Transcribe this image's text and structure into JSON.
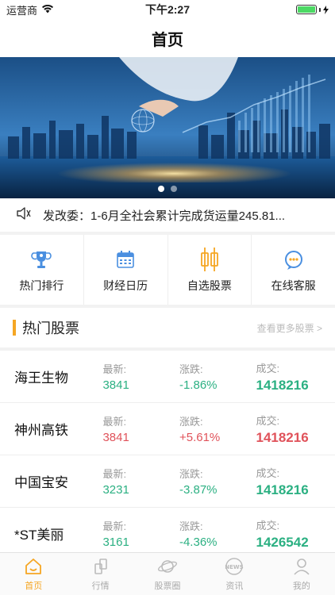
{
  "status": {
    "carrier": "运营商",
    "time": "下午2:27"
  },
  "nav": {
    "title": "首页"
  },
  "banner": {
    "slide_count": 2,
    "active_slide": 1
  },
  "news": {
    "text": "发改委：1-6月全社会累计完成货运量245.81..."
  },
  "quick_menu": [
    {
      "label": "热门排行",
      "icon": "trophy-icon"
    },
    {
      "label": "财经日历",
      "icon": "calendar-icon"
    },
    {
      "label": "自选股票",
      "icon": "candlestick-icon"
    },
    {
      "label": "在线客服",
      "icon": "support-chat-icon"
    }
  ],
  "section": {
    "title": "热门股票",
    "more": "查看更多股票 >"
  },
  "labels": {
    "latest": "最新:",
    "change": "涨跌:",
    "volume": "成交:"
  },
  "stocks": [
    {
      "name": "海王生物",
      "latest": "3841",
      "change": "-1.86%",
      "volume": "1418216",
      "trend": "down"
    },
    {
      "name": "神州高铁",
      "latest": "3841",
      "change": "+5.61%",
      "volume": "1418216",
      "trend": "up"
    },
    {
      "name": "中国宝安",
      "latest": "3231",
      "change": "-3.87%",
      "volume": "1418216",
      "trend": "down"
    },
    {
      "name": "*ST美丽",
      "latest": "3161",
      "change": "-4.36%",
      "volume": "1426542",
      "trend": "down"
    }
  ],
  "tabs": [
    {
      "label": "首页",
      "icon": "home-icon"
    },
    {
      "label": "行情",
      "icon": "market-icon"
    },
    {
      "label": "股票圈",
      "icon": "planet-icon"
    },
    {
      "label": "资讯",
      "icon": "news-icon"
    },
    {
      "label": "我的",
      "icon": "user-icon"
    }
  ],
  "colors": {
    "accent": "#f5a623",
    "down": "#2bb082",
    "up": "#e0525a",
    "battery": "#4cd964"
  }
}
